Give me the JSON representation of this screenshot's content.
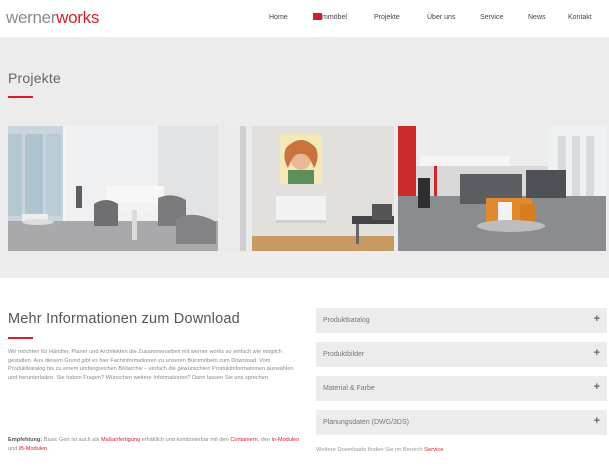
{
  "header": {
    "logo_part1": "werner",
    "logo_part2": "works",
    "nav": [
      {
        "label": "Home"
      },
      {
        "label": "mmöbel"
      },
      {
        "label": "Projekte"
      },
      {
        "label": "Über uns"
      },
      {
        "label": "Service"
      },
      {
        "label": "News"
      },
      {
        "label": "Kontakt"
      }
    ]
  },
  "band": {
    "title": "Projekte",
    "images": [
      {
        "icon": "office-meeting-room-photo"
      },
      {
        "icon": "portrait-artwork-office-photo"
      },
      {
        "icon": "open-plan-office-photo"
      }
    ]
  },
  "info": {
    "title": "Mehr Informationen zum Download",
    "text": "Wir möchten für Händler, Planer und Architekten die Zusammenarbeit mit werner works so einfach wie möglich gestalten. Aus diesem Grund gibt es hier Fachinformationen zu unseren Büromöbeln zum Download. Vom Produktkatalog bis zu einem umfangreichen Bildarchiv – einfach die gewünschten Produktinformationen auswählen und herunterladen. Sie haben Fragen? Wünschen weitere Informationen? Dann lassen Sie uns sprechen.",
    "rec_label": "Empfehlung:",
    "rec_t1": " Basic Gert ist auch als ",
    "rec_l1": "Maßanfertigung",
    "rec_t2": " erhältlich und kombinierbar mit den ",
    "rec_l2": "Containern",
    "rec_t3": ", den ",
    "rec_l3": "in-Modulen",
    "rec_t4": " und ",
    "rec_l4": "iB-Modulen",
    "rec_t5": "."
  },
  "downloads": {
    "items": [
      {
        "label": "Produktkatalog",
        "icon": "plus-icon",
        "symbol": "+"
      },
      {
        "label": "Produktbilder",
        "icon": "plus-icon",
        "symbol": "+"
      },
      {
        "label": "Material & Farbe",
        "icon": "plus-icon",
        "symbol": "+"
      },
      {
        "label": "Planungsdaten (DWG/3DS)",
        "icon": "plus-icon",
        "symbol": "+"
      }
    ],
    "more_text": "Weitere Downloads finden Sie im Bereich ",
    "more_link": "Service"
  },
  "colors": {
    "accent": "#d21f2b",
    "band": "#ececec",
    "text": "#555555"
  }
}
